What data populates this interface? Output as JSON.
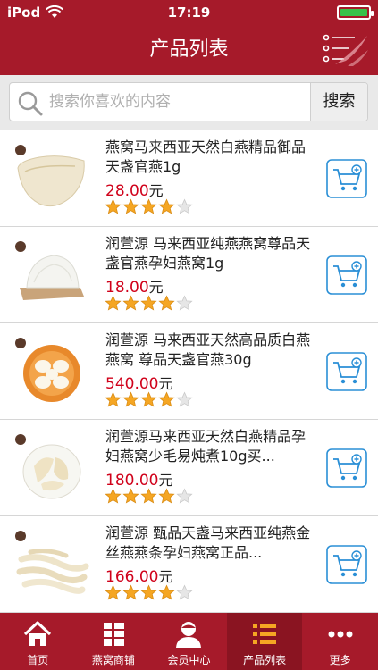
{
  "status_bar": {
    "carrier": "iPod",
    "time": "17:19",
    "battery_level": 1.0
  },
  "header": {
    "title": "产品列表"
  },
  "search": {
    "placeholder": "搜索你喜欢的内容",
    "button_label": "搜索"
  },
  "products": [
    {
      "name": "燕窝马来西亚天然白燕精品御品天盏官燕1g",
      "price": "28.00",
      "unit": "元",
      "rating": 4,
      "max_rating": 5
    },
    {
      "name": "润萱源 马来西亚纯燕燕窝尊品天盏官燕孕妇燕窝1g",
      "price": "18.00",
      "unit": "元",
      "rating": 4,
      "max_rating": 5
    },
    {
      "name": "润萱源 马来西亚天然高品质白燕燕窝 尊品天盏官燕30g",
      "price": "540.00",
      "unit": "元",
      "rating": 4,
      "max_rating": 5
    },
    {
      "name": "润萱源马来西亚天然白燕精品孕妇燕窝少毛易炖煮10g买...",
      "price": "180.00",
      "unit": "元",
      "rating": 4,
      "max_rating": 5
    },
    {
      "name": "润萱源 甄品天盏马来西亚纯燕金丝燕燕条孕妇燕窝正品...",
      "price": "166.00",
      "unit": "元",
      "rating": 4,
      "max_rating": 5
    }
  ],
  "tabs": [
    {
      "label": "首页",
      "icon": "home-icon",
      "active": false
    },
    {
      "label": "燕窝商铺",
      "icon": "grid-icon",
      "active": false
    },
    {
      "label": "会员中心",
      "icon": "user-icon",
      "active": false
    },
    {
      "label": "产品列表",
      "icon": "list-icon",
      "active": true
    },
    {
      "label": "更多",
      "icon": "more-icon",
      "active": false
    }
  ],
  "colors": {
    "brand": "#a61a2a",
    "brand_active": "#8a1421",
    "price": "#d0021b",
    "star": "#f5a623",
    "cart": "#2a8fd6"
  }
}
